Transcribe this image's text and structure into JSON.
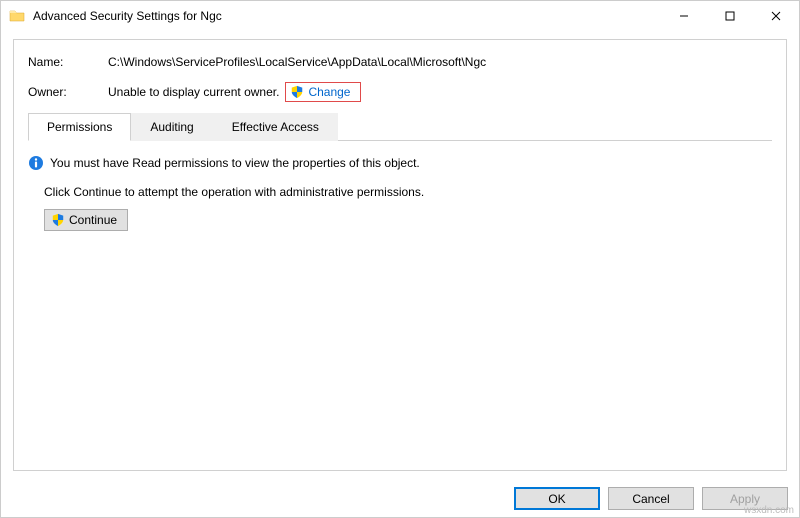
{
  "window": {
    "title": "Advanced Security Settings for Ngc"
  },
  "fields": {
    "name_label": "Name:",
    "name_value": "C:\\Windows\\ServiceProfiles\\LocalService\\AppData\\Local\\Microsoft\\Ngc",
    "owner_label": "Owner:",
    "owner_value": "Unable to display current owner.",
    "change_label": "Change"
  },
  "tabs": {
    "permissions": "Permissions",
    "auditing": "Auditing",
    "effective_access": "Effective Access"
  },
  "body": {
    "info_text": "You must have Read permissions to view the properties of this object.",
    "continue_text": "Click Continue to attempt the operation with administrative permissions.",
    "continue_label": "Continue"
  },
  "buttons": {
    "ok": "OK",
    "cancel": "Cancel",
    "apply": "Apply"
  },
  "watermark": "wsxdn.com"
}
